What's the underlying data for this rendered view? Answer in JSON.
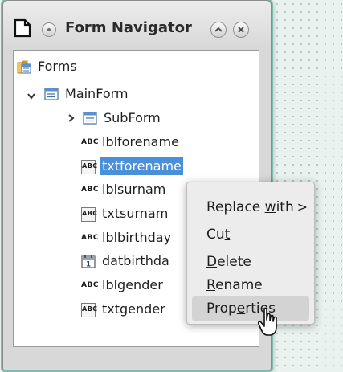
{
  "window": {
    "title": "Form Navigator"
  },
  "tree": {
    "root": {
      "label": "Forms",
      "icon": "forms-folder-icon"
    },
    "main_form": {
      "label": "MainForm",
      "icon": "form-icon",
      "expanded": true
    },
    "sub_form": {
      "label": "SubForm",
      "icon": "form-icon",
      "expanded": false
    },
    "controls": [
      {
        "label": "lblforename",
        "icon": "label-control-icon",
        "icon_text": "ABC"
      },
      {
        "label": "txtforename",
        "icon": "textbox-control-icon",
        "icon_text": "ABC",
        "selected": true
      },
      {
        "label": "lblsurnam",
        "icon": "label-control-icon",
        "icon_text": "ABC"
      },
      {
        "label": "txtsurnam",
        "icon": "textbox-control-icon",
        "icon_text": "ABC"
      },
      {
        "label": "lblbirthday",
        "icon": "label-control-icon",
        "icon_text": "ABC"
      },
      {
        "label": "datbirthda",
        "icon": "date-field-icon",
        "icon_text": "1"
      },
      {
        "label": "lblgender",
        "icon": "label-control-icon",
        "icon_text": "ABC"
      },
      {
        "label": "txtgender",
        "icon": "textbox-control-icon",
        "icon_text": "ABC"
      }
    ]
  },
  "context_menu": {
    "items": [
      {
        "pre": "Replace ",
        "mnemonic": "w",
        "post": "ith",
        "has_submenu": true,
        "submenu_glyph": ">"
      },
      {
        "pre": "Cu",
        "mnemonic": "t",
        "post": ""
      },
      {
        "pre": "",
        "mnemonic": "D",
        "post": "elete"
      },
      {
        "pre": "",
        "mnemonic": "R",
        "post": "ename"
      },
      {
        "pre": "Prop",
        "mnemonic": "e",
        "post": "rties",
        "hovered": true
      }
    ]
  },
  "colors": {
    "selection": "#4a90d9",
    "window_border_accent": "#7fbcae",
    "menu_hover": "#d3d3d3"
  }
}
